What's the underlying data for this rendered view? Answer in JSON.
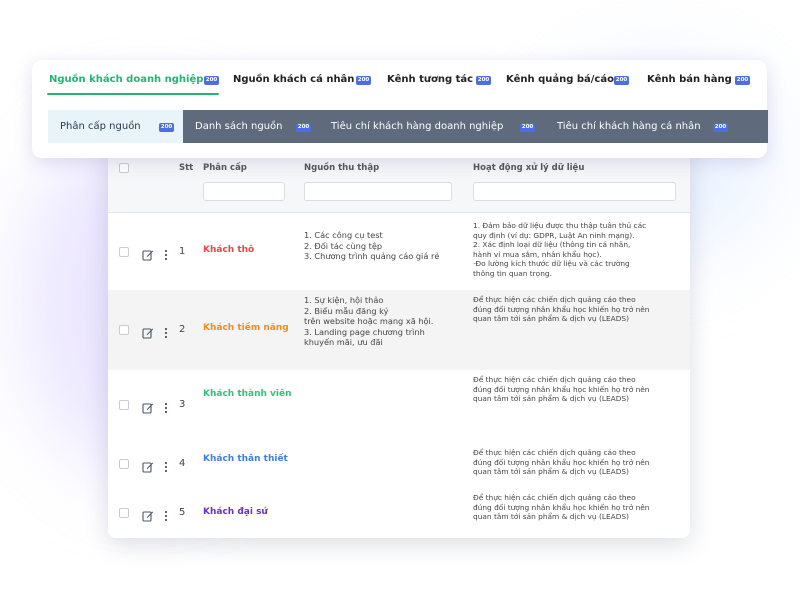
{
  "tabs": [
    {
      "label": "Nguồn khách doanh nghiệp",
      "badge": "200",
      "active": true
    },
    {
      "label": "Nguồn khách cá nhân",
      "badge": "200"
    },
    {
      "label": "Kênh tương tác",
      "badge": "200"
    },
    {
      "label": "Kênh quảng bá/cáo",
      "badge": "200"
    },
    {
      "label": "Kênh bán hàng",
      "badge": "200"
    }
  ],
  "subtabs": [
    {
      "label": "Phân cấp nguồn",
      "badge": "200",
      "active": true
    },
    {
      "label": "Danh sách nguồn",
      "badge": "200"
    },
    {
      "label": "Tiêu chí khách hàng doanh nghiệp",
      "badge": "200"
    },
    {
      "label": "Tiêu chí khách hàng cá nhân",
      "badge": "200"
    }
  ],
  "table": {
    "headers": {
      "stt": "Stt",
      "tier": "Phân cấp",
      "source": "Nguồn thu thập",
      "activity": "Hoạt động xử lý dữ liệu"
    },
    "rows": [
      {
        "stt": "1",
        "tier": "Khách thô",
        "tier_color": "#e8464c",
        "source": [
          "1. Các công cụ test",
          "2. Đối tác cùng tệp",
          "3. Chương trình quảng cáo giá rẻ"
        ],
        "activity": [
          "1. Đảm bảo dữ liệu được thu thập tuân thủ các",
          "quy định (ví dụ: GDPR, Luật An ninh mạng).",
          "2. Xác định loại dữ liệu (thông tin cá nhân,",
          "hành vi mua sắm, nhân khẩu học).",
          "·Đo lường kích thước dữ liệu và các trường",
          "thông tin quan trọng."
        ]
      },
      {
        "stt": "2",
        "tier": "Khách tiềm năng",
        "tier_color": "#f08c1c",
        "source": [
          "1. Sự kiện, hội thảo",
          "2. Biểu mẫu đăng ký",
          "trên website hoặc mạng xã hội.",
          "3. Landing page chương trình",
          "khuyến mãi, ưu đãi"
        ],
        "activity": [
          "Để thực hiện các chiến dịch quảng cáo theo",
          "đúng đối tượng nhân khẩu học khiến họ trở nên",
          "quan tâm tới sản phẩm & dịch vụ (LEADS)"
        ]
      },
      {
        "stt": "3",
        "tier": "Khách thành viên",
        "tier_color": "#35c07c",
        "source": [],
        "activity": [
          "Để thực hiện các chiến dịch quảng cáo theo",
          "đúng đối tượng nhân khẩu học khiến họ trở nên",
          "quan tâm tới sản phẩm & dịch vụ (LEADS)"
        ]
      },
      {
        "stt": "4",
        "tier": "Khách thân thiết",
        "tier_color": "#3f7fe0",
        "source": [],
        "activity": [
          "Để thực hiện các chiến dịch quảng cáo theo",
          "đúng đối tượng nhân khẩu học khiến họ trở nên",
          "quan tâm tới sản phẩm & dịch vụ (LEADS)"
        ]
      },
      {
        "stt": "5",
        "tier": "Khách đại sứ",
        "tier_color": "#6a2fc4",
        "source": [],
        "activity": [
          "Để thực hiện các chiến dịch quảng cáo theo",
          "đúng đối tượng nhân khẩu học khiến họ trở nên",
          "quan tâm tới sản phẩm & dịch vụ (LEADS)"
        ]
      }
    ]
  },
  "colors": {
    "accent_green": "#22b573",
    "badge_blue": "#4b6fe0",
    "subnav_bg": "#5f6a7c"
  }
}
